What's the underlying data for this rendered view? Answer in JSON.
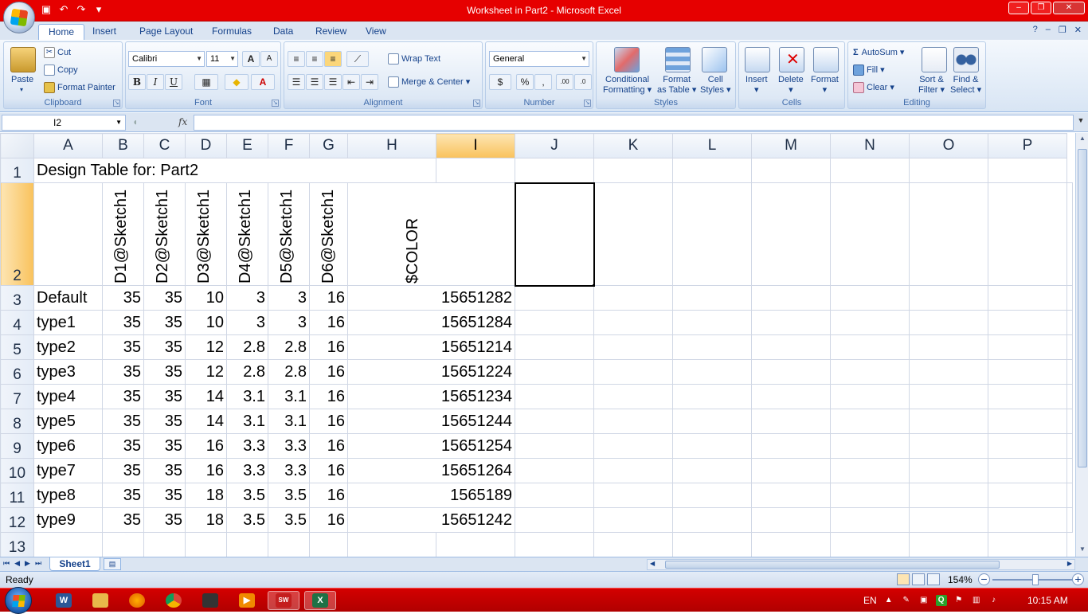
{
  "window": {
    "title": "Worksheet in Part2 - Microsoft Excel",
    "minimize": "–",
    "restore": "❐",
    "close": "✕"
  },
  "tabs": [
    "Home",
    "Insert",
    "Page Layout",
    "Formulas",
    "Data",
    "Review",
    "View"
  ],
  "ribbon": {
    "clipboard": {
      "label": "Clipboard",
      "paste": "Paste",
      "cut": "Cut",
      "copy": "Copy",
      "format_painter": "Format Painter"
    },
    "font": {
      "label": "Font",
      "family": "Calibri",
      "size": "11",
      "grow": "A",
      "shrink": "A",
      "bold": "B",
      "italic": "I",
      "underline": "U"
    },
    "alignment": {
      "label": "Alignment",
      "wrap_text": "Wrap Text",
      "merge_center": "Merge & Center"
    },
    "number": {
      "label": "Number",
      "format": "General",
      "currency": "$",
      "percent": "%",
      "comma": ",",
      "inc_decimal": ".00",
      "dec_decimal": ".0"
    },
    "styles": {
      "label": "Styles",
      "conditional_1": "Conditional",
      "conditional_2": "Formatting",
      "format_table_1": "Format",
      "format_table_2": "as Table",
      "cell_styles_1": "Cell",
      "cell_styles_2": "Styles"
    },
    "cells": {
      "label": "Cells",
      "insert": "Insert",
      "delete": "Delete",
      "format": "Format"
    },
    "editing": {
      "label": "Editing",
      "autosum": "AutoSum",
      "fill": "Fill",
      "clear": "Clear",
      "sort_1": "Sort &",
      "sort_2": "Filter",
      "find_1": "Find &",
      "find_2": "Select"
    }
  },
  "formula_bar": {
    "name_box": "I2",
    "fx": "fx",
    "value": ""
  },
  "sheet": {
    "columns": [
      "A",
      "B",
      "C",
      "D",
      "E",
      "F",
      "G",
      "H",
      "I",
      "J",
      "K",
      "L",
      "M",
      "N",
      "O",
      "P"
    ],
    "selected_column": "I",
    "selected_row": "2",
    "row1": {
      "num": "1",
      "title": "Design Table for: Part2"
    },
    "row2": {
      "num": "2",
      "headers": [
        "D1@Sketch1",
        "D2@Sketch1",
        "D3@Sketch1",
        "D4@Sketch1",
        "D5@Sketch1",
        "D6@Sketch1",
        "$COLOR"
      ]
    },
    "rows": [
      {
        "num": "3",
        "name": "Default",
        "vals": [
          "35",
          "35",
          "10",
          "3",
          "3",
          "16",
          "15651282"
        ]
      },
      {
        "num": "4",
        "name": "type1",
        "vals": [
          "35",
          "35",
          "10",
          "3",
          "3",
          "16",
          "15651284"
        ]
      },
      {
        "num": "5",
        "name": "type2",
        "vals": [
          "35",
          "35",
          "12",
          "2.8",
          "2.8",
          "16",
          "15651214"
        ]
      },
      {
        "num": "6",
        "name": "type3",
        "vals": [
          "35",
          "35",
          "12",
          "2.8",
          "2.8",
          "16",
          "15651224"
        ]
      },
      {
        "num": "7",
        "name": "type4",
        "vals": [
          "35",
          "35",
          "14",
          "3.1",
          "3.1",
          "16",
          "15651234"
        ]
      },
      {
        "num": "8",
        "name": "type5",
        "vals": [
          "35",
          "35",
          "14",
          "3.1",
          "3.1",
          "16",
          "15651244"
        ]
      },
      {
        "num": "9",
        "name": "type6",
        "vals": [
          "35",
          "35",
          "16",
          "3.3",
          "3.3",
          "16",
          "15651254"
        ]
      },
      {
        "num": "10",
        "name": "type7",
        "vals": [
          "35",
          "35",
          "16",
          "3.3",
          "3.3",
          "16",
          "15651264"
        ]
      },
      {
        "num": "11",
        "name": "type8",
        "vals": [
          "35",
          "35",
          "18",
          "3.5",
          "3.5",
          "16",
          "1565189"
        ]
      },
      {
        "num": "12",
        "name": "type9",
        "vals": [
          "35",
          "35",
          "18",
          "3.5",
          "3.5",
          "16",
          "15651242"
        ]
      }
    ],
    "row13": {
      "num": "13"
    }
  },
  "sheet_tabs": {
    "active": "Sheet1"
  },
  "status": {
    "text": "Ready",
    "zoom": "154%"
  },
  "taskbar": {
    "lang": "EN",
    "time": "10:15 AM"
  }
}
